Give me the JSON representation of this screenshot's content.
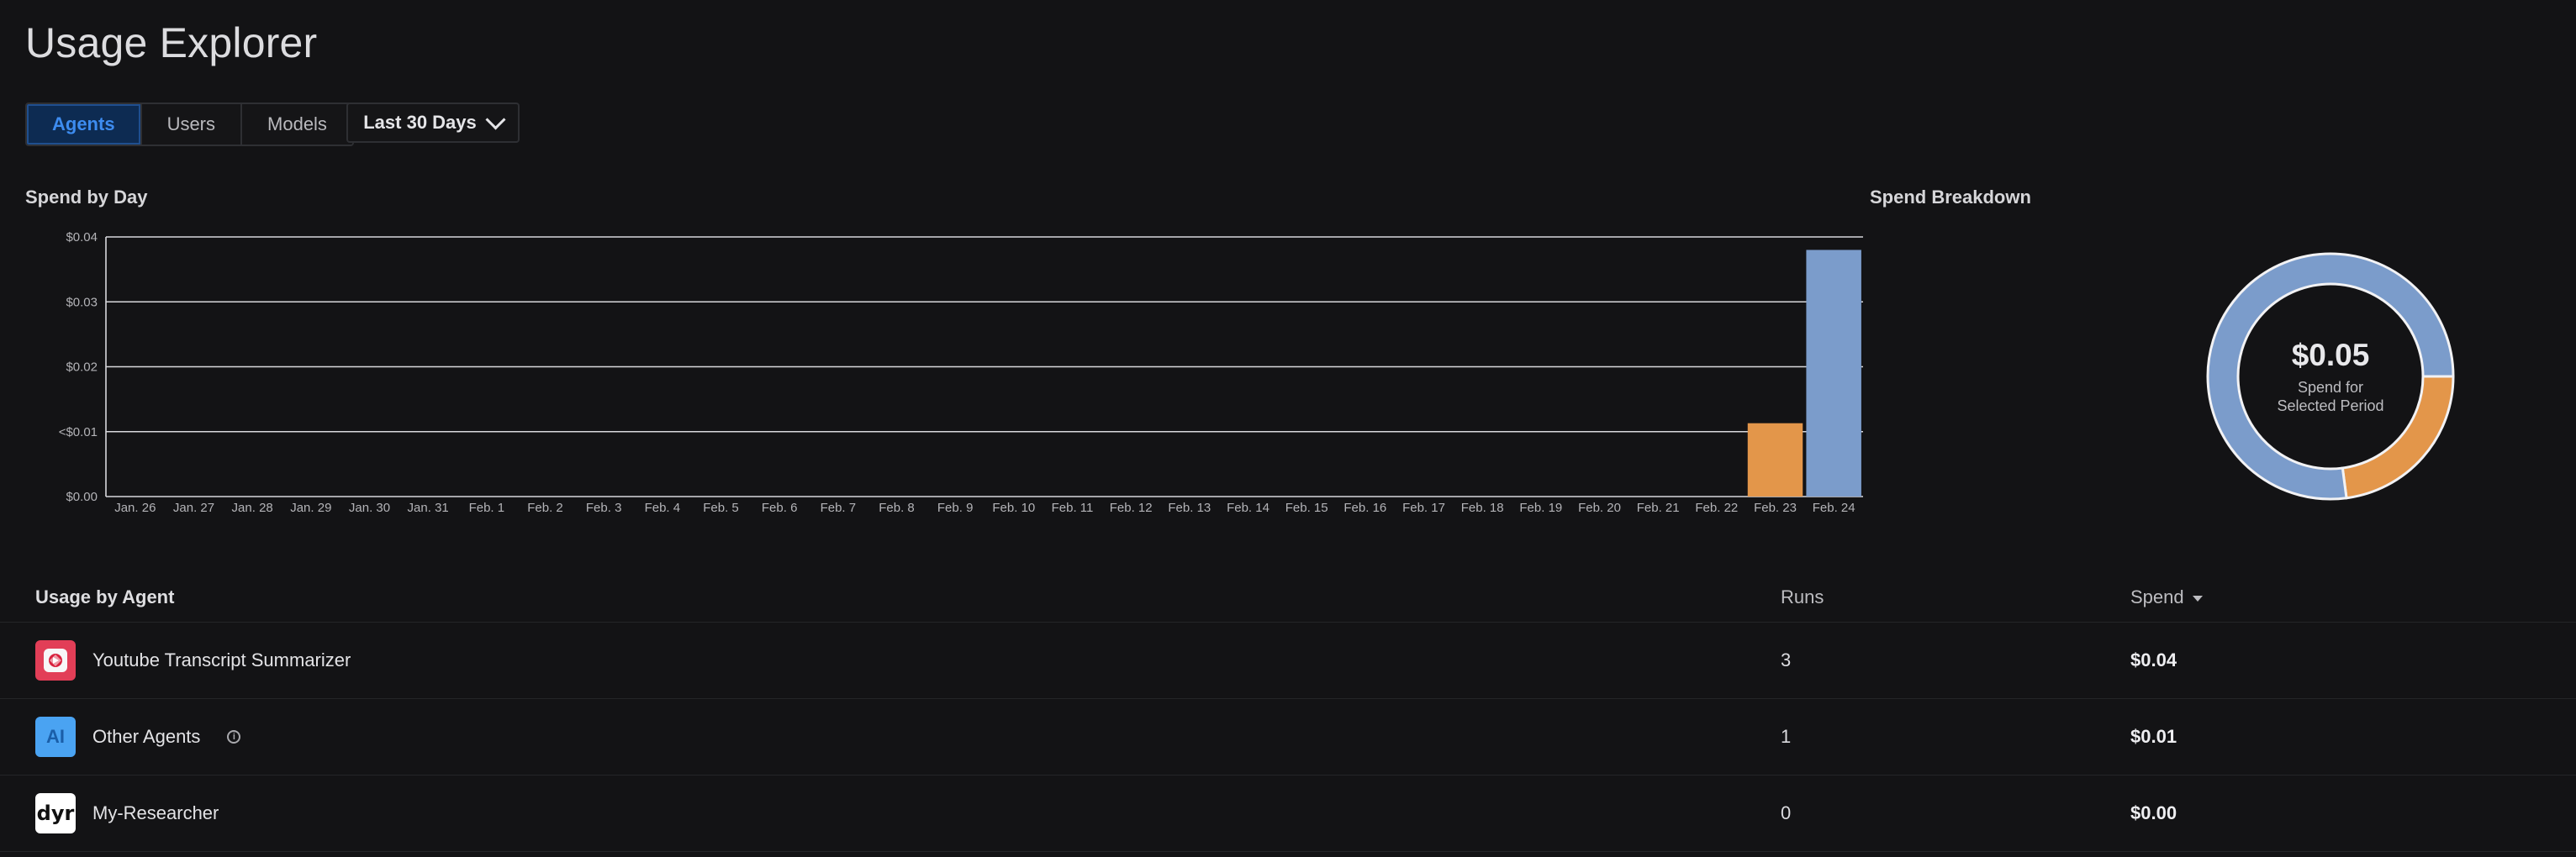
{
  "page": {
    "title": "Usage Explorer"
  },
  "view_tabs": [
    {
      "label": "Agents",
      "active": true
    },
    {
      "label": "Users",
      "active": false
    },
    {
      "label": "Models",
      "active": false
    }
  ],
  "period_select": {
    "label": "Last 30 Days"
  },
  "spend_by_day": {
    "title": "Spend by Day"
  },
  "spend_breakdown": {
    "title": "Spend Breakdown",
    "total": "$0.05",
    "caption": "Spend for Selected Period"
  },
  "chart_data": [
    {
      "type": "bar",
      "title": "Spend by Day",
      "categories": [
        "Jan. 26",
        "Jan. 27",
        "Jan. 28",
        "Jan. 29",
        "Jan. 30",
        "Jan. 31",
        "Feb. 1",
        "Feb. 2",
        "Feb. 3",
        "Feb. 4",
        "Feb. 5",
        "Feb. 6",
        "Feb. 7",
        "Feb. 8",
        "Feb. 9",
        "Feb. 10",
        "Feb. 11",
        "Feb. 12",
        "Feb. 13",
        "Feb. 14",
        "Feb. 15",
        "Feb. 16",
        "Feb. 17",
        "Feb. 18",
        "Feb. 19",
        "Feb. 20",
        "Feb. 21",
        "Feb. 22",
        "Feb. 23",
        "Feb. 24"
      ],
      "values": [
        0,
        0,
        0,
        0,
        0,
        0,
        0,
        0,
        0,
        0,
        0,
        0,
        0,
        0,
        0,
        0,
        0,
        0,
        0,
        0,
        0,
        0,
        0,
        0,
        0,
        0,
        0,
        0,
        0.0113,
        0.038
      ],
      "bar_colors": {
        "Feb. 23": "#e3964a",
        "Feb. 24": "#7b9ccb"
      },
      "ylim": [
        0,
        0.04
      ],
      "yticks": [
        0,
        0.01,
        0.02,
        0.03,
        0.04
      ],
      "ytick_labels": [
        "$0.00",
        "<$0.01",
        "$0.02",
        "$0.03",
        "$0.04"
      ],
      "grid": true,
      "xlabel": "",
      "ylabel": ""
    },
    {
      "type": "pie",
      "title": "Spend Breakdown",
      "donut": true,
      "slices": [
        {
          "label": "Youtube Transcript Summarizer",
          "value": 0.038,
          "color": "#7b9ccb"
        },
        {
          "label": "Other Agents",
          "value": 0.0113,
          "color": "#e3964a"
        }
      ]
    }
  ],
  "usage_table": {
    "title": "Usage by Agent",
    "columns": {
      "runs": "Runs",
      "spend": "Spend"
    },
    "rows": [
      {
        "name": "Youtube Transcript Summarizer",
        "icon": "youtube-summarizer-icon",
        "runs": "3",
        "spend": "$0.04"
      },
      {
        "name": "Other Agents",
        "icon": "ai-icon",
        "icon_text": "AI",
        "runs": "1",
        "spend": "$0.01"
      },
      {
        "name": "My-Researcher",
        "icon": "dyr-icon",
        "icon_text": "dyr",
        "runs": "0",
        "spend": "$0.00"
      }
    ]
  },
  "colors": {
    "accent": "#3d8cf0",
    "bar_blue": "#7b9ccb",
    "bar_orange": "#e3964a",
    "background": "#131315"
  }
}
